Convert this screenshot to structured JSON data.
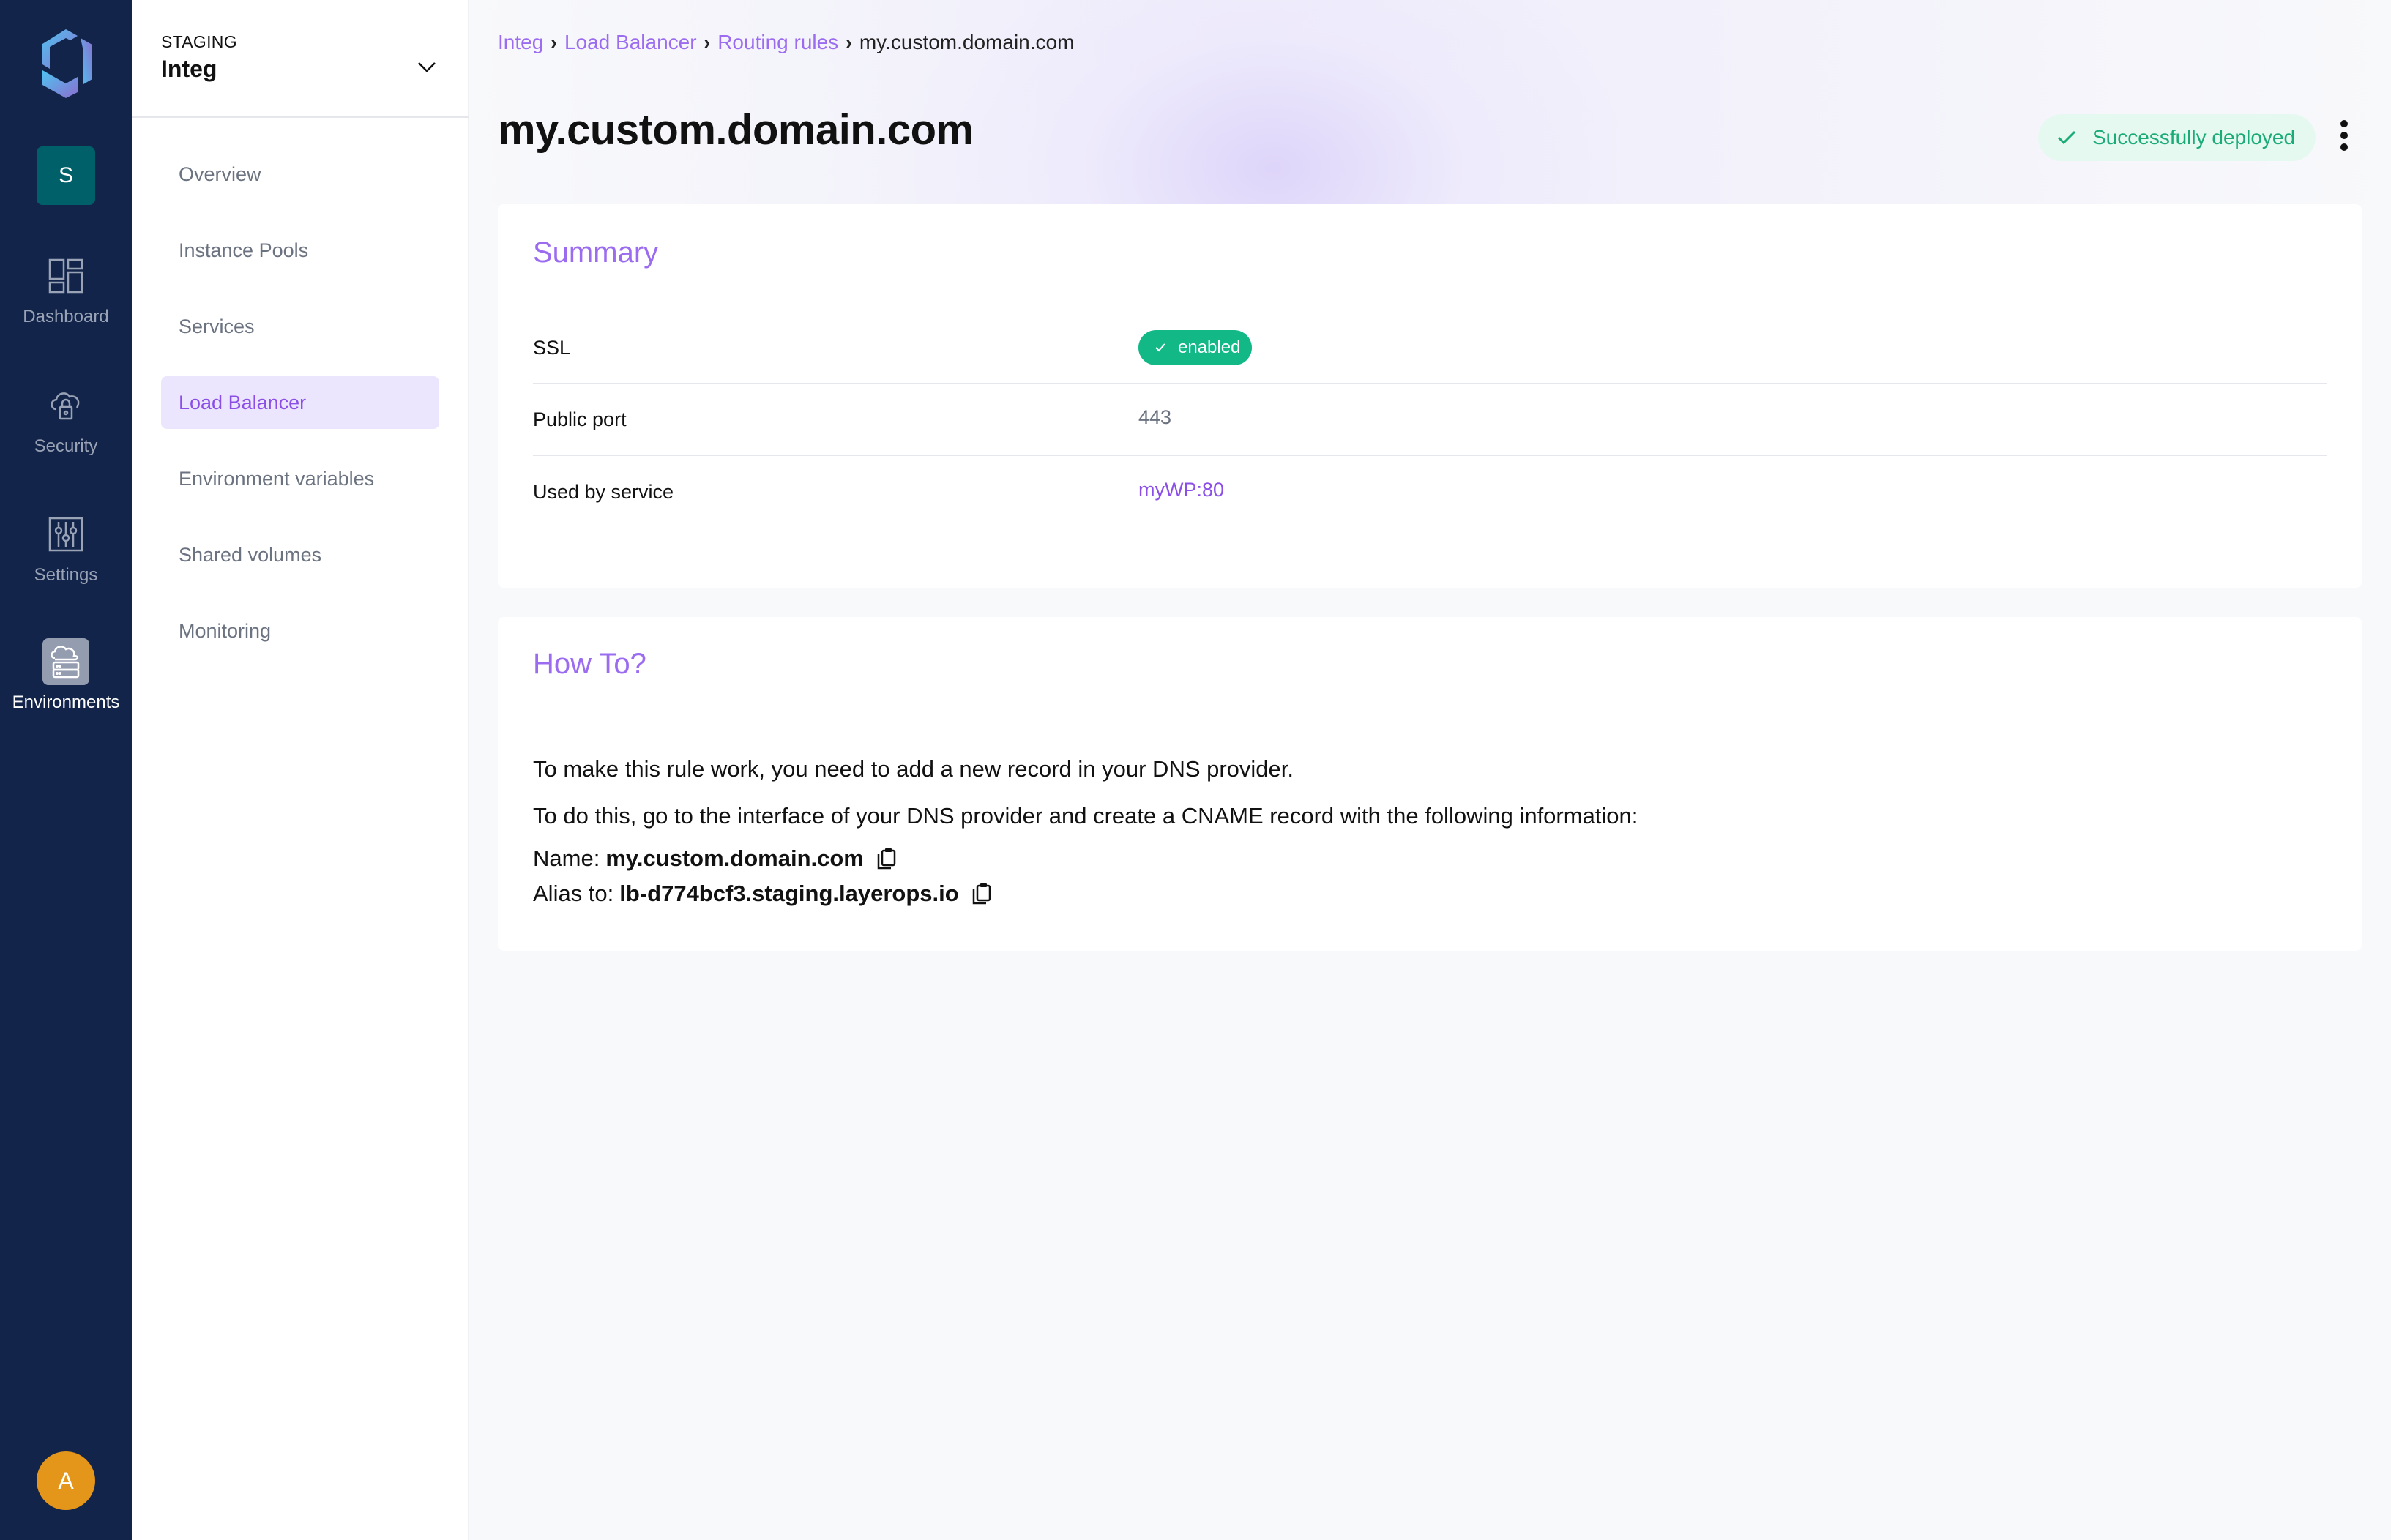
{
  "rail": {
    "org_initial": "S",
    "user_initial": "A",
    "items": [
      {
        "label": "Dashboard",
        "icon": "dashboard-icon"
      },
      {
        "label": "Security",
        "icon": "cloud-lock-icon"
      },
      {
        "label": "Settings",
        "icon": "sliders-icon"
      },
      {
        "label": "Environments",
        "icon": "cloud-server-icon",
        "active": true
      }
    ]
  },
  "environment": {
    "type": "STAGING",
    "name": "Integ"
  },
  "subnav": {
    "items": [
      {
        "label": "Overview"
      },
      {
        "label": "Instance Pools"
      },
      {
        "label": "Services"
      },
      {
        "label": "Load Balancer",
        "active": true
      },
      {
        "label": "Environment variables"
      },
      {
        "label": "Shared volumes"
      },
      {
        "label": "Monitoring"
      }
    ]
  },
  "breadcrumb": {
    "items": [
      "Integ",
      "Load Balancer",
      "Routing rules"
    ],
    "separator": "›",
    "current": "my.custom.domain.com"
  },
  "header": {
    "title": "my.custom.domain.com",
    "status": "Successfully deployed"
  },
  "summary": {
    "title": "Summary",
    "rows": [
      {
        "key": "SSL",
        "value": "enabled"
      },
      {
        "key": "Public port",
        "value": "443"
      },
      {
        "key": "Used by service",
        "value": "myWP:80"
      }
    ]
  },
  "howto": {
    "title": "How To?",
    "line1": "To make this rule work, you need to add a new record in your DNS provider.",
    "line2": "To do this, go to the interface of your DNS provider and create a CNAME record with the following information:",
    "name_label": "Name:",
    "name_value": "my.custom.domain.com",
    "alias_label": "Alias to:",
    "alias_value": "lb-d774bcf3.staging.layerops.io"
  },
  "colors": {
    "rail_bg": "#12244a",
    "accent": "#8b4fe8",
    "success": "#12b886",
    "org_badge": "#00606a",
    "user_avatar": "#e3961a"
  }
}
